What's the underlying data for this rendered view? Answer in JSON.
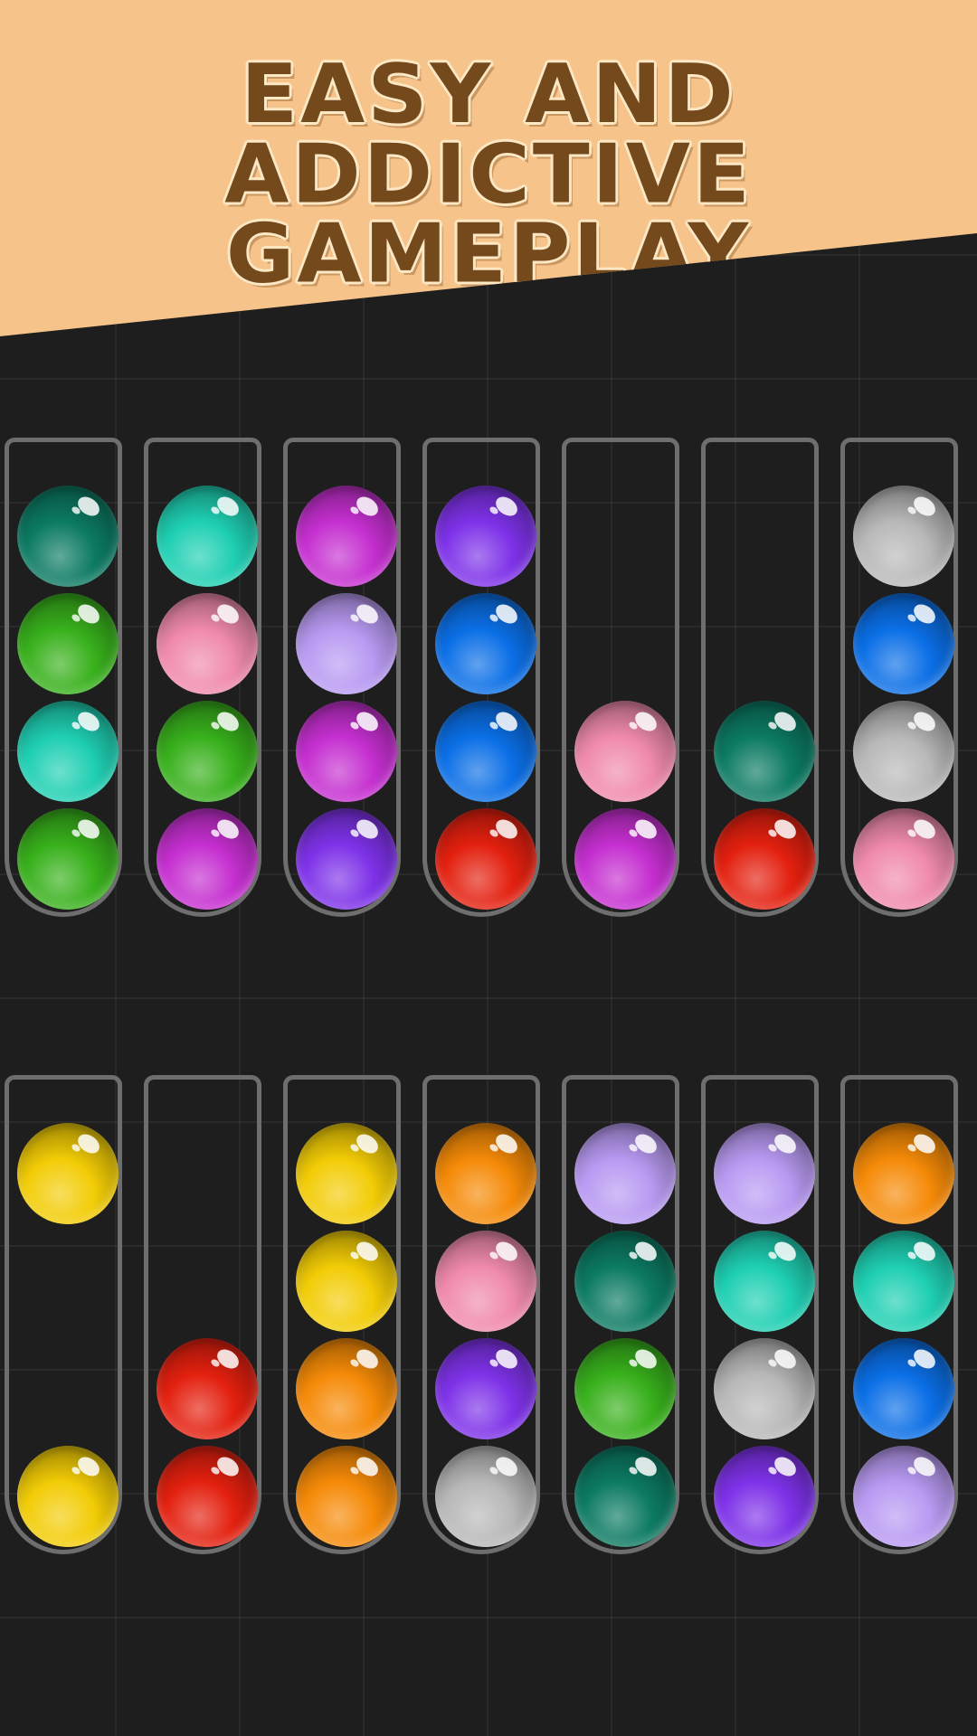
{
  "banner": {
    "line1": "EASY AND ADDICTIVE",
    "line2": "GAMEPLAY",
    "bg_color": "#f6c48a",
    "text_color": "#744a1c",
    "text_outline_color": "#fde8c6"
  },
  "board": {
    "tube_border_color": "#6e6e6e",
    "tube_capacity": 4,
    "rows": [
      {
        "tubes": [
          [
            "dark-teal",
            "green",
            "teal",
            "green"
          ],
          [
            "teal",
            "pink",
            "green",
            "magenta"
          ],
          [
            "magenta",
            "lavender",
            "magenta",
            "purple"
          ],
          [
            "purple",
            "blue",
            "blue",
            "red"
          ],
          [
            null,
            null,
            "pink",
            "magenta"
          ],
          [
            null,
            null,
            "dark-teal",
            "red"
          ],
          [
            "gray",
            "blue",
            "gray",
            "pink"
          ]
        ]
      },
      {
        "tubes": [
          [
            "yellow",
            null,
            null,
            "yellow"
          ],
          [
            null,
            null,
            "red",
            "red"
          ],
          [
            "yellow",
            "yellow",
            "orange",
            "orange"
          ],
          [
            "orange",
            "pink",
            "purple",
            "gray"
          ],
          [
            "lavender",
            "dark-teal",
            "green",
            "dark-teal"
          ],
          [
            "lavender",
            "teal",
            "gray",
            "purple"
          ],
          [
            "orange",
            "teal",
            "blue",
            "lavender"
          ]
        ]
      }
    ]
  },
  "colors": {
    "dark-teal": "#0c7a62",
    "green": "#38b01c",
    "teal": "#1fcfb2",
    "pink": "#f08aad",
    "magenta": "#c52fd0",
    "lavender": "#b89af2",
    "purple": "#7e32e8",
    "blue": "#0b6fe6",
    "red": "#e3200f",
    "gray": "#b8b8b8",
    "yellow": "#f2cc06",
    "orange": "#f58a08"
  }
}
